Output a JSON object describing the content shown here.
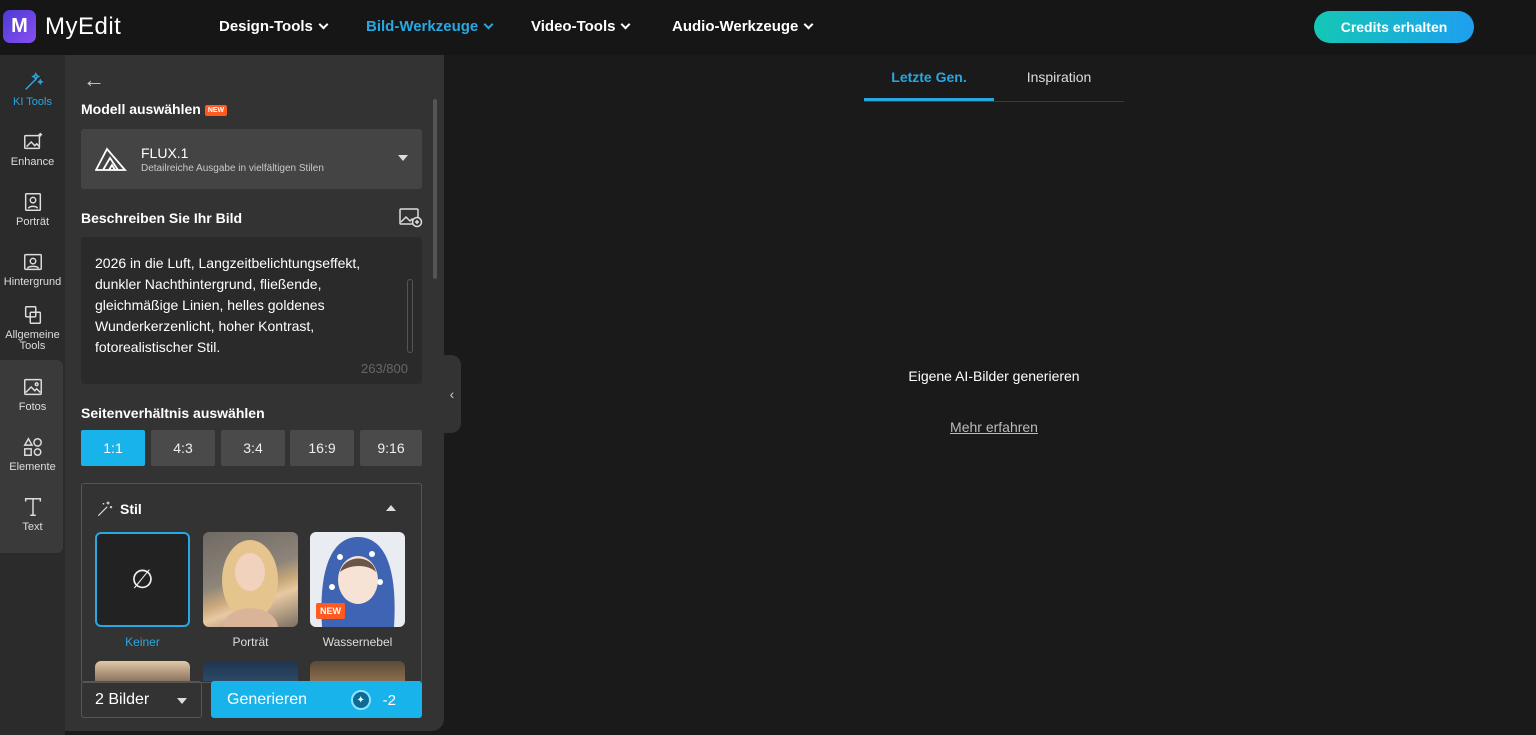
{
  "app": {
    "name": "MyEdit",
    "logo_letter": "M"
  },
  "nav": [
    {
      "label": "Design-Tools",
      "active": false
    },
    {
      "label": "Bild-Werkzeuge",
      "active": true
    },
    {
      "label": "Video-Tools",
      "active": false
    },
    {
      "label": "Audio-Werkzeuge",
      "active": false
    }
  ],
  "header": {
    "credits_button": "Credits erhalten"
  },
  "rail": {
    "items": [
      {
        "label": "KI Tools",
        "icon": "magic-wand-icon",
        "active": true
      },
      {
        "label": "Enhance",
        "icon": "image-enhance-icon"
      },
      {
        "label": "Porträt",
        "icon": "portrait-icon"
      },
      {
        "label": "Hintergrund",
        "icon": "background-icon"
      },
      {
        "label": "Allgemeine Tools",
        "icon": "tools-icon"
      },
      {
        "label": "Fotos",
        "icon": "photos-icon"
      },
      {
        "label": "Elemente",
        "icon": "shapes-icon"
      },
      {
        "label": "Text",
        "icon": "text-icon"
      }
    ]
  },
  "panel": {
    "model_section": {
      "title": "Modell auswählen",
      "badge": "NEW"
    },
    "model": {
      "name": "FLUX.1",
      "description": "Detailreiche Ausgabe in vielfältigen Stilen"
    },
    "prompt_section": {
      "title": "Beschreiben Sie Ihr Bild"
    },
    "prompt": {
      "text": "2026 in die Luft, Langzeitbelichtungseffekt, dunkler Nachthintergrund, fließende, gleichmäßige Linien, helles goldenes Wunderkerzenlicht, hoher Kontrast, fotorealistischer Stil.",
      "counter": "263/800"
    },
    "ratio_section": {
      "title": "Seitenverhältnis auswählen"
    },
    "ratios": [
      {
        "label": "1:1",
        "active": true
      },
      {
        "label": "4:3"
      },
      {
        "label": "3:4"
      },
      {
        "label": "16:9"
      },
      {
        "label": "9:16"
      }
    ],
    "style_section": {
      "title": "Stil",
      "styles": [
        {
          "label": "Keiner",
          "active": true
        },
        {
          "label": "Porträt"
        },
        {
          "label": "Wassernebel",
          "badge": "NEW"
        }
      ]
    },
    "image_count": "2 Bilder",
    "generate": {
      "label": "Generieren",
      "cost": "-2"
    }
  },
  "results": {
    "tabs": [
      {
        "label": "Letzte Gen.",
        "active": true
      },
      {
        "label": "Inspiration"
      }
    ],
    "empty_title": "Eigene AI-Bilder generieren",
    "learn_more": "Mehr erfahren"
  },
  "colors": {
    "accent": "#29a7e1",
    "button": "#18b3ea",
    "badge": "#ff5a1f"
  }
}
